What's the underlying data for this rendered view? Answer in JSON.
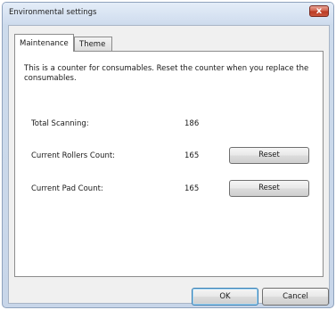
{
  "window": {
    "title": "Environmental settings",
    "close_glyph": "x"
  },
  "tabs": [
    {
      "label": "Maintenance",
      "active": true
    },
    {
      "label": "Theme",
      "active": false
    }
  ],
  "maintenance": {
    "description": "This is a counter for consumables. Reset the counter when you replace the consumables.",
    "rows": [
      {
        "label": "Total Scanning:",
        "value": "186"
      },
      {
        "label": "Current Rollers Count:",
        "value": "165",
        "button": "Reset"
      },
      {
        "label": "Current Pad Count:",
        "value": "165",
        "button": "Reset"
      }
    ]
  },
  "buttons": {
    "ok": "OK",
    "cancel": "Cancel"
  },
  "colors": {
    "title_gradient_top": "#e4edf8",
    "close_button": "#c9553c",
    "default_button_border": "#3c7fb1"
  }
}
